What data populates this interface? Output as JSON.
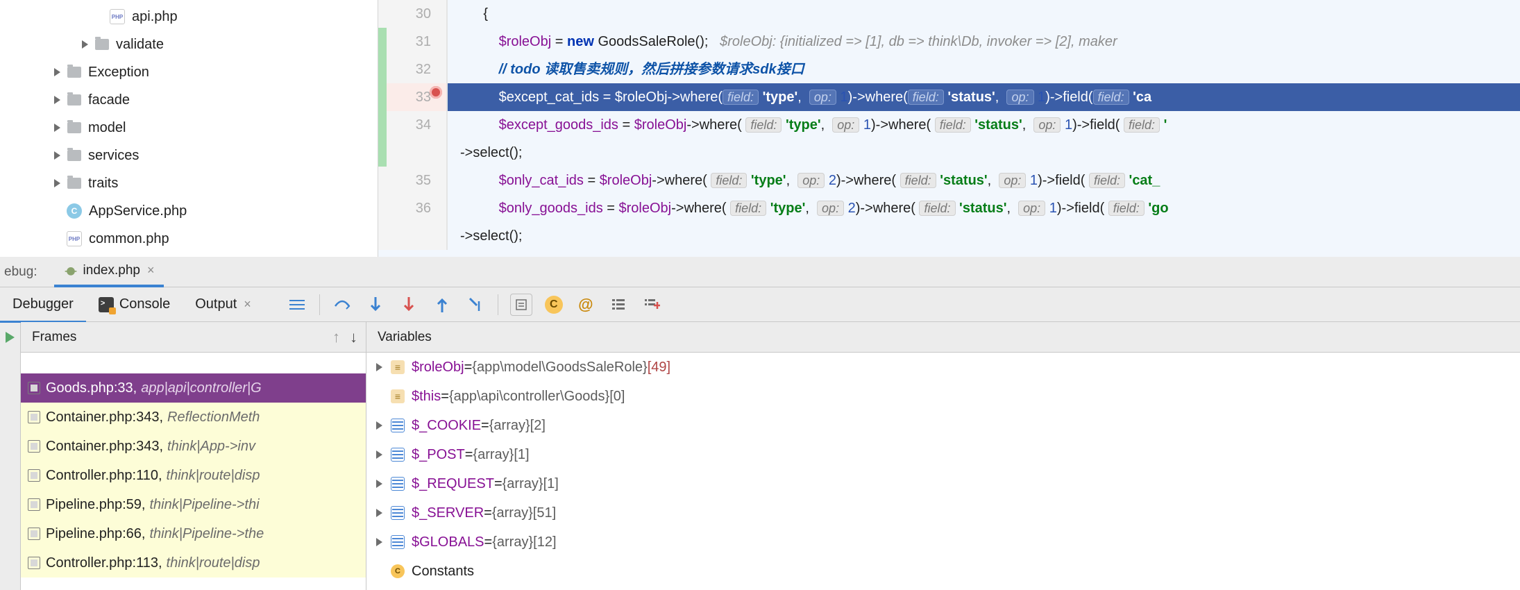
{
  "tree": {
    "api_php": "api.php",
    "validate": "validate",
    "exception": "Exception",
    "facade": "facade",
    "model": "model",
    "services": "services",
    "traits": "traits",
    "appservice": "AppService.php",
    "common": "common.php"
  },
  "editor": {
    "ln30": "30",
    "ln31": "31",
    "ln32": "32",
    "ln33": "33",
    "ln34": "34",
    "ln35": "35",
    "ln36": "36",
    "c30": "{",
    "c31_var": "$roleObj",
    "c31_eq": " = ",
    "c31_new": "new",
    "c31_cls": " GoodsSaleRole();",
    "c31_com": "   $roleObj: {initialized => [1], db => think\\Db, invoker => [2], maker",
    "c32_pre": "// ",
    "c32_todo": "todo",
    "c32_txt": " 读取售卖规则，然后拼接参数请求sdk接口",
    "c33_var": "$except_cat_ids",
    "c33_eq": " = ",
    "c33_v2": "$roleObj",
    "c33_w1": "->where(",
    "c33_f1": "field:",
    "c33_s1": "'type'",
    "c33_c1": ",  ",
    "c33_o1": "op:",
    "c33_n1": " 1",
    "c33_w2": ")->where(",
    "c33_s2": "'status'",
    "c33_c2": ",  ",
    "c33_n2": " 1",
    "c33_w3": ")->field(",
    "c33_s3": "'ca",
    "c34_var": "$except_goods_ids",
    "c34_eq": " = ",
    "c34_v2": "$roleObj",
    "c34_w1": "->where( ",
    "c34_f1": "field:",
    "c34_s1": " 'type'",
    "c34_c1": ",  ",
    "c34_o1": "op:",
    "c34_n1": " 1",
    "c34_w2": ")->where( ",
    "c34_s2": "'status'",
    "c34_c2": ",  ",
    "c34_n2": " 1",
    "c34_w3": ")->field( ",
    "c34_s3": "'",
    "c34_sel": "->select();",
    "c35_var": "$only_cat_ids",
    "c35_eq": " = ",
    "c35_v2": "$roleObj",
    "c35_w1": "->where( ",
    "c35_s1": " 'type'",
    "c35_n1": " 2",
    "c35_s2": " 'status'",
    "c35_n2": " 1",
    "c35_s3": " 'cat_",
    "c36_var": "$only_goods_ids",
    "c36_eq": " = ",
    "c36_v2": "$roleObj",
    "c36_w1": "->where( ",
    "c36_s1": " 'type'",
    "c36_n1": " 2",
    "c36_s2": " 'status'",
    "c36_n2": " 1",
    "c36_s3": " 'go",
    "c36_sel": "->select();"
  },
  "tabs": {
    "debug": "ebug:",
    "index": "index.php"
  },
  "toolbar": {
    "debugger": "Debugger",
    "console": "Console",
    "output": "Output"
  },
  "frames": {
    "header": "Frames",
    "r0_name": "Goods.php:33,",
    "r0_ctx": "app|api|controller|G",
    "r1_name": "Container.php:343,",
    "r1_ctx": "ReflectionMeth",
    "r2_name": "Container.php:343,",
    "r2_ctx": "think|App->inv",
    "r3_name": "Controller.php:110,",
    "r3_ctx": "think|route|disp",
    "r4_name": "Pipeline.php:59,",
    "r4_ctx": "think|Pipeline->thi",
    "r5_name": "Pipeline.php:66,",
    "r5_ctx": "think|Pipeline->the",
    "r6_name": "Controller.php:113,",
    "r6_ctx": "think|route|disp"
  },
  "vars": {
    "header": "Variables",
    "v0_name": "$roleObj",
    "v0_eq": " = ",
    "v0_val": "{app\\model\\GoodsSaleRole} ",
    "v0_n": "[49]",
    "v1_name": "$this",
    "v1_eq": " = ",
    "v1_val": "{app\\api\\controller\\Goods} ",
    "v1_n": "[0]",
    "v2_name": "$_COOKIE",
    "v2_eq": " = ",
    "v2_val": "{array} ",
    "v2_n": "[2]",
    "v3_name": "$_POST",
    "v3_eq": " = ",
    "v3_val": "{array} ",
    "v3_n": "[1]",
    "v4_name": "$_REQUEST",
    "v4_eq": " = ",
    "v4_val": "{array} ",
    "v4_n": "[1]",
    "v5_name": "$_SERVER",
    "v5_eq": " = ",
    "v5_val": "{array} ",
    "v5_n": "[51]",
    "v6_name": "$GLOBALS",
    "v6_eq": " = ",
    "v6_val": "{array} ",
    "v6_n": "[12]",
    "v7_name": "Constants"
  }
}
